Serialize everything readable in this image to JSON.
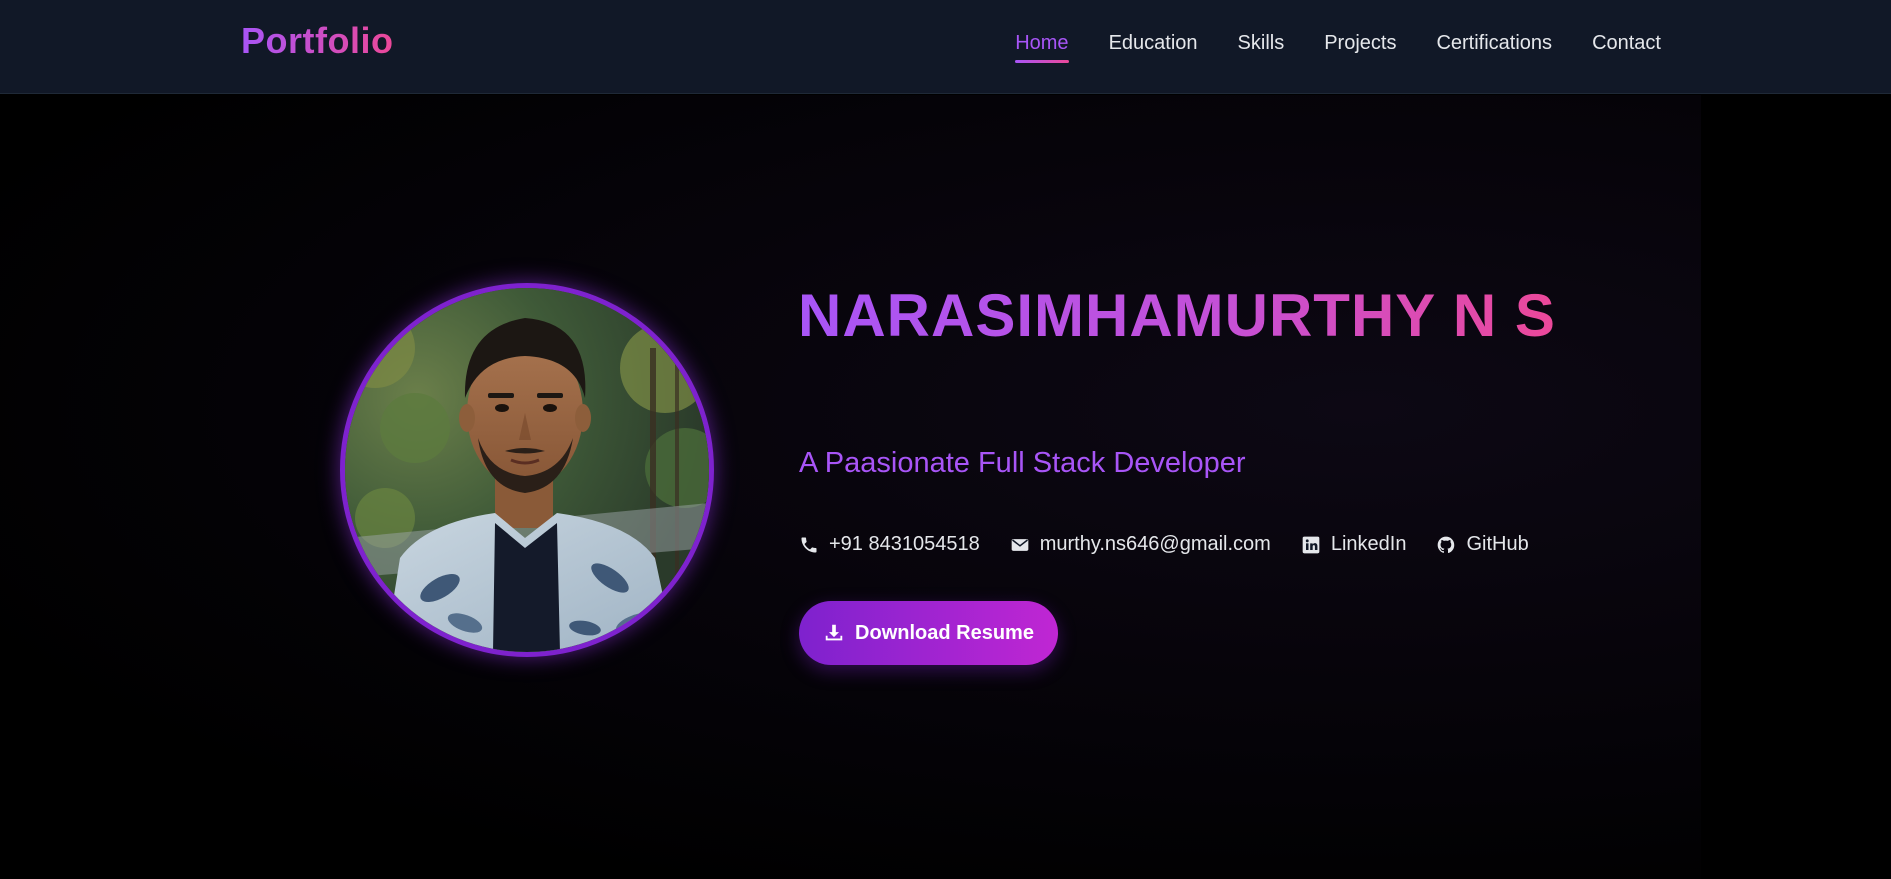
{
  "brand": {
    "name": "Portfolio"
  },
  "nav": {
    "items": [
      {
        "label": "Home",
        "active": true
      },
      {
        "label": "Education",
        "active": false
      },
      {
        "label": "Skills",
        "active": false
      },
      {
        "label": "Projects",
        "active": false
      },
      {
        "label": "Certifications",
        "active": false
      },
      {
        "label": "Contact",
        "active": false
      }
    ]
  },
  "hero": {
    "name": "NARASIMHAMURTHY N S",
    "tagline": "A Paasionate Full Stack Developer",
    "contacts": {
      "phone": {
        "label": "+91 8431054518",
        "icon": "phone-icon"
      },
      "email": {
        "label": "murthy.ns646@gmail.com",
        "icon": "envelope-icon"
      },
      "linkedin": {
        "label": "LinkedIn",
        "icon": "linkedin-icon"
      },
      "github": {
        "label": "GitHub",
        "icon": "github-icon"
      }
    },
    "download_button": {
      "label": "Download Resume",
      "icon": "download-icon"
    },
    "avatar": {
      "icon": "profile-photo"
    }
  },
  "colors": {
    "nav_bg": "#111827",
    "accent_purple": "#a855f7",
    "accent_pink": "#ec4899",
    "button_start": "#7e22ce",
    "button_end": "#c026d3"
  }
}
